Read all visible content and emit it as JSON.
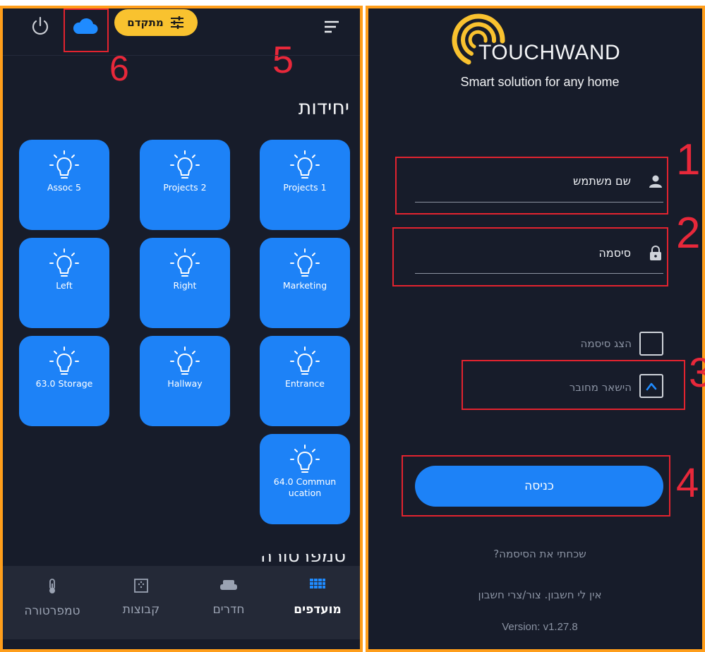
{
  "left_screen": {
    "advanced_button": "מתקדם",
    "annotation_6": "6",
    "annotation_5": "5",
    "section_title": "יחידות",
    "next_section_title": "טמפרטורה",
    "tiles": [
      {
        "label": "Projects 1"
      },
      {
        "label": "Projects 2"
      },
      {
        "label": "Assoc 5"
      },
      {
        "label": "Marketing"
      },
      {
        "label": "Right"
      },
      {
        "label": "Left"
      },
      {
        "label": "Entrance"
      },
      {
        "label": "Hallway"
      },
      {
        "label": "63.0 Storage"
      },
      {
        "label": "64.0 Commun ucation"
      }
    ],
    "bottom_nav": [
      {
        "label": "מועדפים",
        "icon": "grid-icon",
        "active": true
      },
      {
        "label": "חדרים",
        "icon": "sofa-icon",
        "active": false
      },
      {
        "label": "קבוצות",
        "icon": "group-icon",
        "active": false
      },
      {
        "label": "טמפרטורה",
        "icon": "thermometer-icon",
        "active": false
      }
    ]
  },
  "right_screen": {
    "logo_text_1": "TOUCH",
    "logo_text_2": "WAND",
    "tagline": "Smart solution for any home",
    "username_label": "שם משתמש",
    "password_label": "סיסמה",
    "show_password_label": "הצג סיסמה",
    "stay_connected_label": "הישאר מחובר",
    "login_button": "כניסה",
    "forgot_password": "שכחתי את הסיסמה?",
    "no_account": "אין לי חשבון. צור/צרי חשבון",
    "version": "Version: v1.27.8",
    "annotation_1": "1",
    "annotation_2": "2",
    "annotation_3": "3",
    "annotation_4": "4"
  },
  "colors": {
    "panel_border": "#ff9e1b",
    "background": "#171c2a",
    "tile_blue": "#1d82f7",
    "advanced_yellow": "#f9c22f",
    "annotation_red": "#e2232f"
  }
}
